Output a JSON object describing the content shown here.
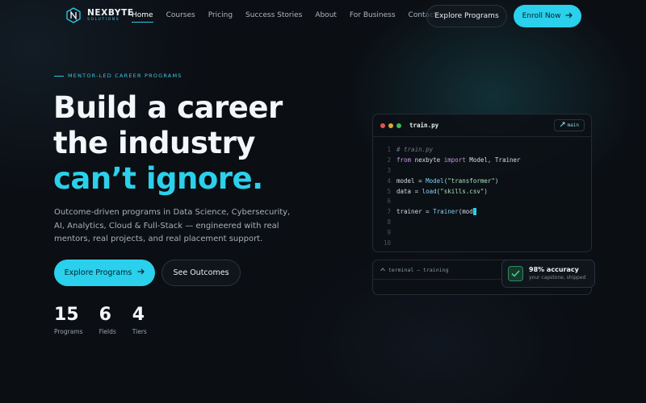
{
  "brand": {
    "name": "NEXBYTE",
    "tagline": "SOLUTIONS",
    "accent": "#2ad0ec",
    "logo_icon": "n-hexagon-icon"
  },
  "nav": {
    "links": [
      "Home",
      "Courses",
      "Pricing",
      "Success Stories",
      "About",
      "For Business",
      "Contact"
    ],
    "active": "Home",
    "explore_label": "Explore Programs",
    "enroll_label": "Enroll Now",
    "enroll_icon": "arrow-right-icon"
  },
  "hero": {
    "eyebrow": "MENTOR-LED CAREER PROGRAMS",
    "headline_part1": "Build a career the industry ",
    "headline_accent": "can’t ignore.",
    "subtext": "Outcome-driven programs in Data Science, Cybersecurity, AI, Analytics, Cloud & Full-Stack — engineered with real mentors, real projects, and real placement support.",
    "primary_cta": "Explore Programs",
    "secondary_cta": "See Outcomes",
    "stats": [
      {
        "value": "15",
        "label": "Programs"
      },
      {
        "value": "6",
        "label": "Fields"
      },
      {
        "value": "4",
        "label": "Tiers"
      }
    ]
  },
  "editor": {
    "filename": "train.py",
    "branch": "main",
    "branch_icon": "git-branch-icon",
    "window_dots": [
      "#e5534b",
      "#e0a63a",
      "#3fb950"
    ],
    "line_numbers": [
      "1",
      "2",
      "3",
      "4",
      "5",
      "6",
      "7",
      "8",
      "9",
      "10"
    ],
    "code": {
      "comment": "# train.py",
      "from_kw": "from",
      "module": " nexbyte ",
      "import_kw": "import",
      "imports": " Model, Trainer",
      "model_var": "model = ",
      "model_fn": "Model",
      "model_arg": "(\"transformer\")",
      "data_var": "data = ",
      "data_fn": "load",
      "data_arg": "(\"skills.csv\")",
      "trainer_var": "trainer = ",
      "trainer_fn": "Trainer",
      "trainer_arg": "(mod"
    }
  },
  "terminal": {
    "title": "terminal — training",
    "icon": "terminal-caret-icon"
  },
  "badge": {
    "title": "98% accuracy",
    "subtitle": "your capstone, shipped",
    "icon": "checkmark-icon"
  }
}
